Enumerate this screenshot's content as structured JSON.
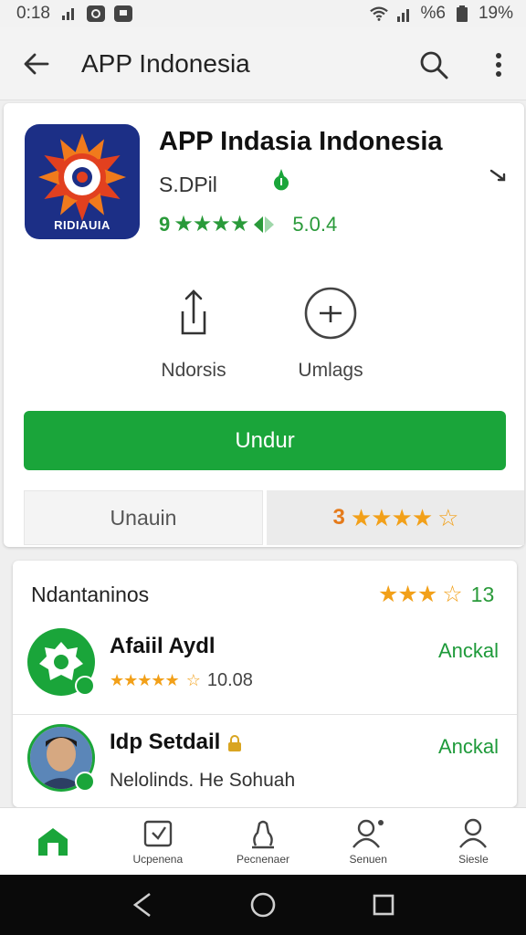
{
  "status_bar": {
    "time": "0:18",
    "battery_text": "19%",
    "signal_text": "%6"
  },
  "app_bar": {
    "title": "APP Indonesia",
    "back_icon": "arrow-left-icon",
    "search_icon": "search-icon",
    "more_icon": "more-vert-icon"
  },
  "app": {
    "name": "APP Indasia Indonesia",
    "developer": "S.DPil",
    "icon_text": "RIDIAUIA",
    "rating_prefix": "9",
    "rating_value": "5.0.4",
    "accent_color": "#1aa53a"
  },
  "actions": [
    {
      "label": "Ndorsis",
      "icon": "share-upload-icon"
    },
    {
      "label": "Umlags",
      "icon": "add-circle-icon"
    }
  ],
  "install_button": {
    "label": "Undur"
  },
  "tabs": {
    "left_label": "Unauin",
    "right_number": "3",
    "right_stars": "★★★★",
    "right_empty_star": "☆"
  },
  "reviews": {
    "header": "Ndantaninos",
    "count": "13",
    "items": [
      {
        "name": "Afaiil Aydl",
        "action": "Anckal",
        "stars": "★★★★★",
        "empty_stars": "☆",
        "score": "10.08"
      },
      {
        "name": "Idp Setdail",
        "action": "Anckal",
        "text": "Nelolinds. He Sohuah"
      }
    ]
  },
  "bottom_nav": [
    {
      "label": "",
      "icon": "home-icon"
    },
    {
      "label": "Ucpenena",
      "icon": "tag-icon"
    },
    {
      "label": "Pecnenaer",
      "icon": "hand-icon"
    },
    {
      "label": "Senuen",
      "icon": "person-settings-icon"
    },
    {
      "label": "Siesle",
      "icon": "person-icon"
    }
  ]
}
